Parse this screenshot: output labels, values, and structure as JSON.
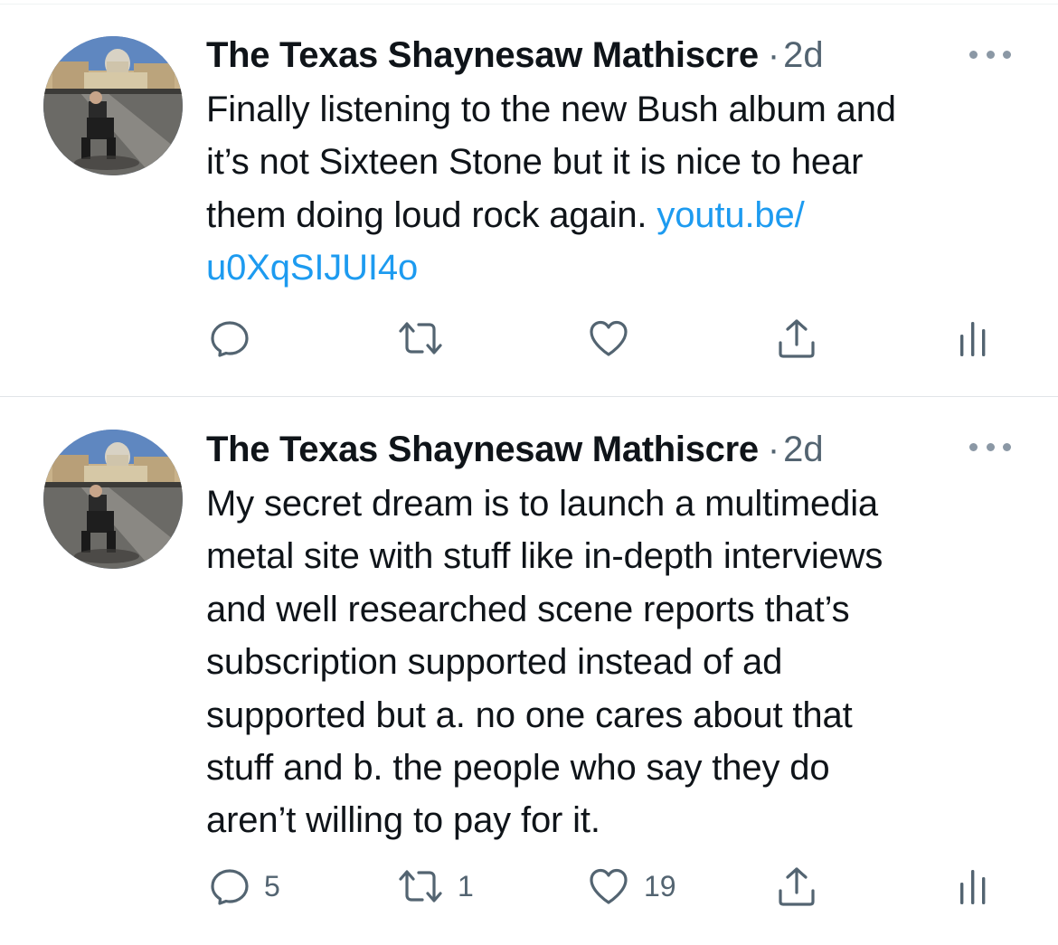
{
  "tweets": [
    {
      "display_name": "The Texas Shaynesaw Mathiscre",
      "separator": "·",
      "timestamp": "2d",
      "text_before_link": "Finally listening to the new Bush album and\nit’s not Sixteen Stone but it is nice to hear\nthem doing loud rock again. ",
      "link_text": "youtu.be/\nu0XqSIJUI4o",
      "replies": "",
      "retweets": "",
      "likes": ""
    },
    {
      "display_name": "The Texas Shaynesaw Mathiscre",
      "separator": "·",
      "timestamp": "2d",
      "text": "My secret dream is to launch a multimedia\nmetal site with stuff like in-depth interviews\nand well researched  scene reports that’s\nsubscription supported instead of ad\nsupported but a. no one cares about that\nstuff and b. the people who say they do\naren’t willing to pay for it.",
      "replies": "5",
      "retweets": "1",
      "likes": "19"
    }
  ],
  "icons": {
    "reply": "speech-bubble",
    "retweet": "two-arrows-square",
    "like": "heart",
    "share": "upload-arrow",
    "analytics": "bar-chart",
    "more": "three-dots"
  },
  "colors": {
    "text": "#0f1419",
    "secondary": "#536471",
    "link": "#1d9bf0",
    "divider": "#e1e5e8"
  }
}
